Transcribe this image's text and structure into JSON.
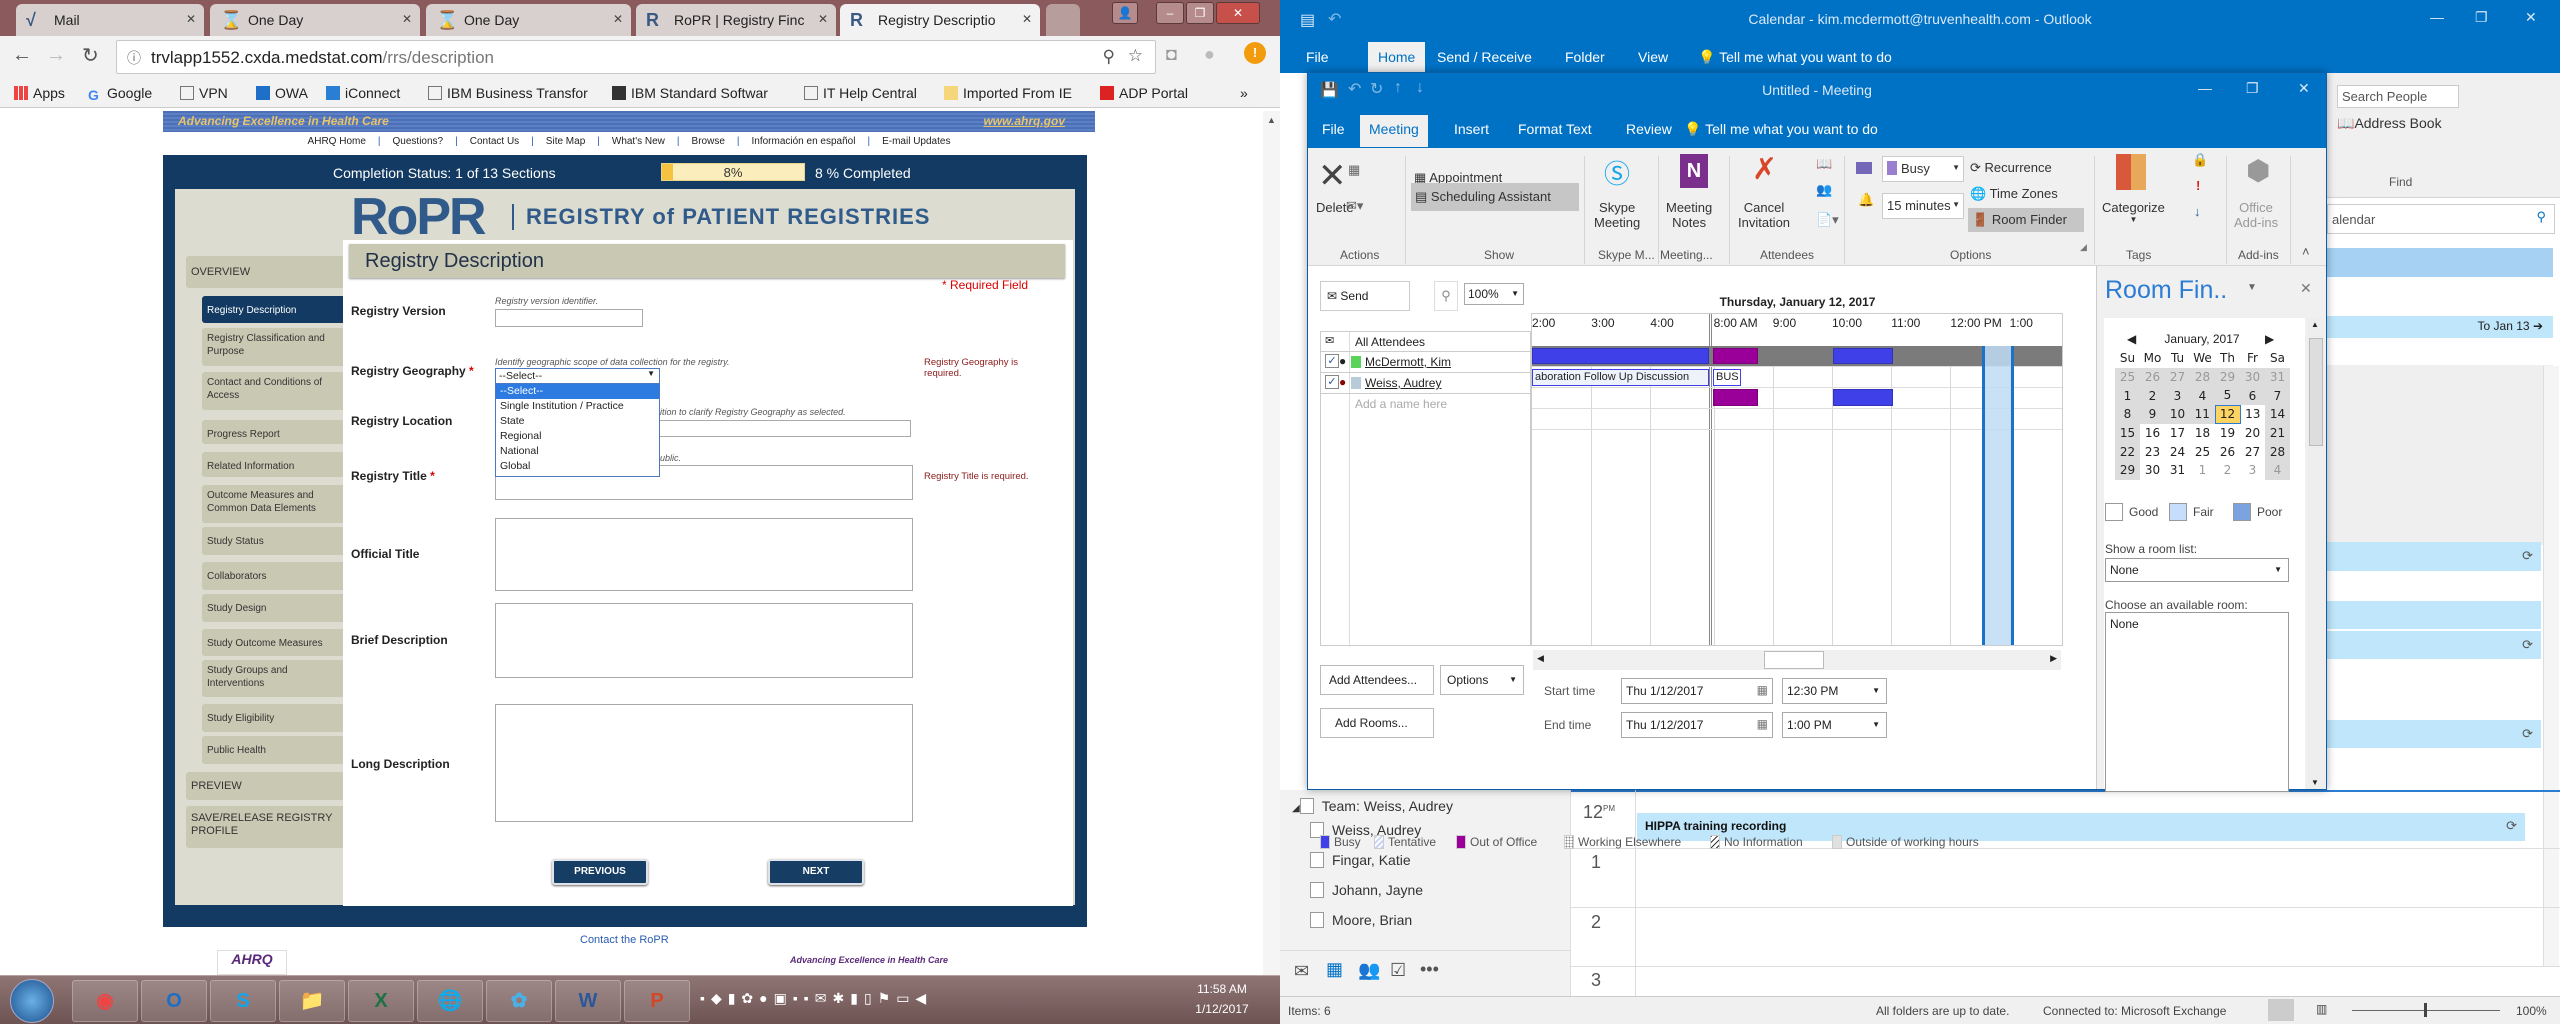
{
  "browser": {
    "tabs": [
      {
        "label": "Mail",
        "icon": "vmail-icon"
      },
      {
        "label": "One Day",
        "icon": "hourglass-icon"
      },
      {
        "label": "One Day",
        "icon": "hourglass-icon"
      },
      {
        "label": "RoPR | Registry Finc",
        "icon": "ropr-icon"
      },
      {
        "label": "Registry Descriptio",
        "icon": "ropr-icon",
        "active": true
      }
    ],
    "url_host": "trvlapp1552.cxda.medstat.com",
    "url_path": "/rrs/description",
    "bookmarks": [
      "Apps",
      "Google",
      "VPN",
      "OWA",
      "iConnect",
      "IBM Business Transfor",
      "IBM Standard Softwar",
      "IT Help Central",
      "Imported From IE",
      "ADP Portal"
    ],
    "more": "»"
  },
  "page": {
    "banner_left": "Advancing Excellence in Health Care",
    "banner_right": "www.ahrq.gov",
    "top_links": [
      "AHRQ Home",
      "Questions?",
      "Contact Us",
      "Site Map",
      "What's New",
      "Browse",
      "Información en español",
      "E-mail Updates"
    ],
    "completion_label": "Completion Status: 1 of 13 Sections",
    "progress_percent": 8,
    "progress_text": "8%",
    "completed_text": "8 % Completed",
    "logo": "RoPR",
    "logo_sub": "REGISTRY of PATIENT REGISTRIES",
    "heading": "Registry Description",
    "required_note": "* Required Field",
    "nav_overview": "OVERVIEW",
    "nav": [
      "Registry Description",
      "Registry Classification and Purpose",
      "Contact and Conditions of Access",
      "Progress Report",
      "Related Information",
      "Outcome Measures and Common Data Elements",
      "Study Status",
      "Collaborators",
      "Study Design",
      "Study Outcome Measures",
      "Study Groups and Interventions",
      "Study Eligibility",
      "Public Health"
    ],
    "nav_preview": "PREVIEW",
    "nav_save": "SAVE/RELEASE REGISTRY PROFILE",
    "fields": {
      "version_label": "Registry Version",
      "version_hint": "Registry version identifier.",
      "geography_label": "Registry Geography",
      "geography_hint": "Identify geographic scope of data collection for the registry.",
      "geography_value": "--Select--",
      "geography_options": [
        "--Select--",
        "Single Institution / Practice",
        "State",
        "Regional",
        "National",
        "Global"
      ],
      "geography_error": "Registry Geography is required.",
      "location_label": "Registry Location",
      "location_hint": "ition to clarify Registry Geography as selected.",
      "title_label": "Registry Title",
      "title_hint": "ublic.",
      "title_error": "Registry Title is required.",
      "official_label": "Official Title",
      "brief_label": "Brief Description",
      "long_label": "Long Description",
      "asterisk": "*"
    },
    "previous": "PREVIOUS",
    "next": "NEXT",
    "contact": "Contact the RoPR",
    "footer_logo": "AHRQ",
    "footer_tagline": "Advancing Excellence in Health Care"
  },
  "taskbar": {
    "apps": [
      "Chrome",
      "Outlook",
      "Skype",
      "Explorer",
      "Excel",
      "Network",
      "Collaboration",
      "Word",
      "PowerPoint"
    ],
    "time": "11:58 AM",
    "date": "1/12/2017"
  },
  "outlook": {
    "title": "Calendar - kim.mcdermott@truvenhealth.com  -  Outlook",
    "tabs": [
      "File",
      "Home",
      "Send / Receive",
      "Folder",
      "View"
    ],
    "tell_me": "Tell me what you want to do",
    "search_people": "Search People",
    "address_book": "Address Book",
    "find_group": "Find",
    "search_calendar": "alendar",
    "to_jan": "To Jan 13",
    "folders": {
      "team": "Team: Weiss, Audrey",
      "members": [
        "Weiss, Audrey",
        "Fingar, Katie",
        "Johann, Jayne",
        "Moore, Brian"
      ]
    },
    "day_view": {
      "hours": [
        {
          "h": "12",
          "ampm": "PM"
        },
        {
          "h": "1"
        },
        {
          "h": "2"
        },
        {
          "h": "3"
        }
      ],
      "event": "HIPPA training recording"
    },
    "status": {
      "items": "Items: 6",
      "sync": "All folders are up to date.",
      "connection": "Connected to: Microsoft Exchange",
      "zoom": "100%"
    }
  },
  "meeting": {
    "title": "Untitled  -  Meeting",
    "tabs": [
      "File",
      "Meeting",
      "Insert",
      "Format Text",
      "Review"
    ],
    "tell_me": "Tell me what you want to do",
    "ribbon": {
      "delete": "Delete",
      "appointment": "Appointment",
      "scheduling_assistant": "Scheduling Assistant",
      "skype1": "Skype",
      "skype2": "Meeting",
      "notes1": "Meeting",
      "notes2": "Notes",
      "cancel1": "Cancel",
      "cancel2": "Invitation",
      "show_as": "Busy",
      "reminder": "15 minutes",
      "recurrence": "Recurrence",
      "time_zones": "Time Zones",
      "room_finder": "Room Finder",
      "categorize": "Categorize",
      "addins1": "Office",
      "addins2": "Add-ins",
      "groups": [
        "Actions",
        "Show",
        "Skype M...",
        "Meeting...",
        "Attendees",
        "Options",
        "Tags",
        "Add-ins"
      ]
    },
    "send": "Send",
    "zoom": "100%",
    "date_header": "Thursday, January 12, 2017",
    "time_labels": [
      "2:00",
      "3:00",
      "4:00",
      "8:00 AM",
      "9:00",
      "10:00",
      "11:00",
      "12:00 PM",
      "1:00"
    ],
    "attendees": [
      {
        "name": "All Attendees"
      },
      {
        "name": "McDermott, Kim",
        "checked": true
      },
      {
        "name": "Weiss, Audrey",
        "checked": true
      }
    ],
    "add_name": "Add a name here",
    "kim_event": "aboration Follow Up Discussion",
    "kim_busy": "BUS",
    "add_attendees": "Add Attendees...",
    "options": "Options",
    "add_rooms": "Add Rooms...",
    "start_label": "Start time",
    "end_label": "End time",
    "start_date": "Thu 1/12/2017",
    "start_time": "12:30 PM",
    "end_date": "Thu 1/12/2017",
    "end_time": "1:00 PM",
    "legend": [
      {
        "label": "Busy",
        "color": "#4040e8"
      },
      {
        "label": "Tentative",
        "color": "#c8d0f8"
      },
      {
        "label": "Out of Office",
        "color": "#9a0099"
      },
      {
        "label": "Working Elsewhere",
        "color": "#d8d8d8"
      },
      {
        "label": "No Information",
        "color": "#ffffff"
      },
      {
        "label": "Outside of working hours",
        "color": "#e0e0e0"
      }
    ]
  },
  "room_finder": {
    "title": "Room Fin..",
    "month": "January, 2017",
    "weekdays": [
      "Su",
      "Mo",
      "Tu",
      "We",
      "Th",
      "Fr",
      "Sa"
    ],
    "weeks": [
      [
        25,
        26,
        27,
        28,
        29,
        30,
        31
      ],
      [
        1,
        2,
        3,
        4,
        5,
        6,
        7
      ],
      [
        8,
        9,
        10,
        11,
        12,
        13,
        14
      ],
      [
        15,
        16,
        17,
        18,
        19,
        20,
        21
      ],
      [
        22,
        23,
        24,
        25,
        26,
        27,
        28
      ],
      [
        29,
        30,
        31,
        1,
        2,
        3,
        4
      ]
    ],
    "selected_day": 12,
    "legend": [
      "Good",
      "Fair",
      "Poor"
    ],
    "room_list_label": "Show a room list:",
    "room_list_value": "None",
    "choose_label": "Choose an available room:",
    "rooms": [
      "None"
    ]
  },
  "colors": {
    "outlook_blue": "#0072c6",
    "ropr_navy": "#123a62",
    "busy": "#4040e8",
    "out_of_office": "#9a0099",
    "selected_day": "#fdd362"
  }
}
